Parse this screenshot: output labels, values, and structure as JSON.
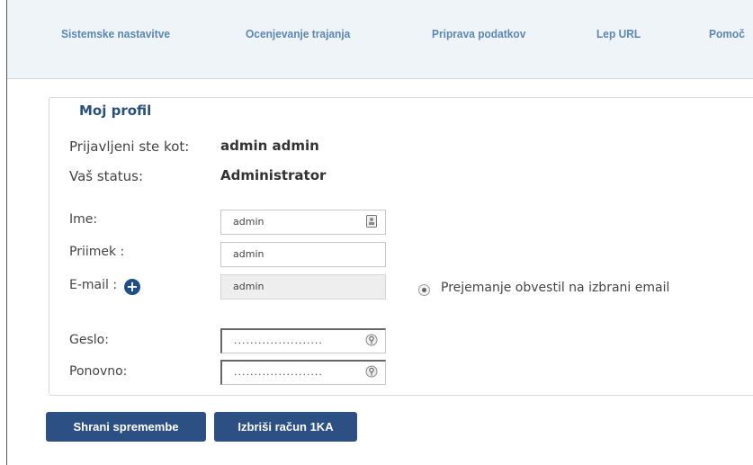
{
  "nav": [
    {
      "label": "Sistemske nastavitve"
    },
    {
      "label": "Ocenjevanje trajanja"
    },
    {
      "label": "Priprava podatkov"
    },
    {
      "label": "Lep URL"
    },
    {
      "label": "Pomoč"
    }
  ],
  "profile": {
    "legend": "Moj profil",
    "logged_in_label": "Prijavljeni ste kot:",
    "logged_in_value": "admin admin",
    "status_label": "Vaš status:",
    "status_value": "Administrator",
    "name_label": "Ime:",
    "name_value": "admin",
    "surname_label": "Priimek :",
    "surname_value": "admin",
    "email_label": "E-mail :",
    "email_value": "admin",
    "notify_label": "Prejemanje obvestil na izbrani email",
    "password_label": "Geslo:",
    "password_value": "......................",
    "repeat_label": "Ponovno:",
    "repeat_value": "......................"
  },
  "buttons": {
    "save": "Shrani spremembe",
    "delete": "Izbriši račun 1KA"
  }
}
